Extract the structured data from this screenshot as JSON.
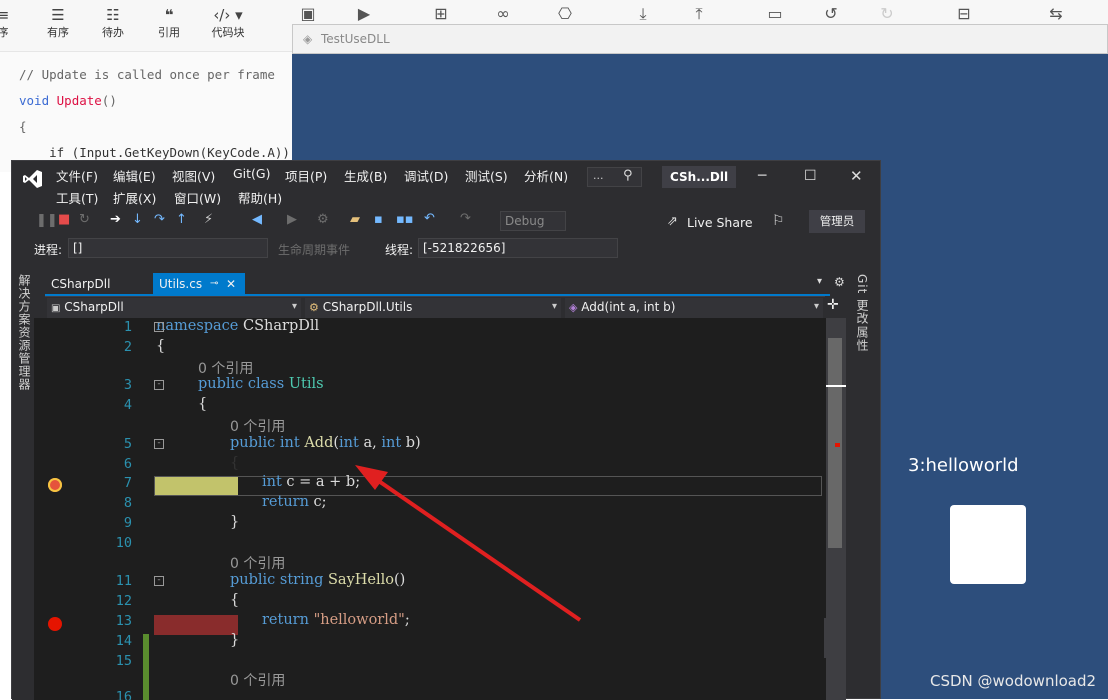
{
  "md_toolbar": {
    "items": [
      {
        "label": "序",
        "icon": "ordered-icon"
      },
      {
        "label": "有序",
        "icon": "ordered-list-icon"
      },
      {
        "label": "待办",
        "icon": "todo-icon"
      },
      {
        "label": "引用",
        "icon": "quote-icon"
      },
      {
        "label": "代码块",
        "icon": "code-block-icon"
      }
    ]
  },
  "md_code": {
    "line1": "// Update is called once per frame",
    "line2_kw": "void",
    "line2_fn": "Update",
    "line2_rest": "()",
    "line3": "{",
    "line4": "    if (Input.GetKeyDown(KeyCode.A))"
  },
  "unity": {
    "title": "TestUseDLL",
    "output_text": "3:helloworld",
    "watermark": "CSDN @wodownload2"
  },
  "vs": {
    "menu_row1": [
      "文件(F)",
      "编辑(E)",
      "视图(V)",
      "Git(G)",
      "项目(P)",
      "生成(B)",
      "调试(D)",
      "测试(S)",
      "分析(N)"
    ],
    "menu_row2": [
      "工具(T)",
      "扩展(X)",
      "窗口(W)",
      "帮助(H)"
    ],
    "search_placeholder": "...",
    "title": "CSh...Dll",
    "config": "Debug",
    "live_share": "Live Share",
    "admin": "管理员",
    "process_label": "进程:",
    "process_value": "[]",
    "lifecycle_label": "生命周期事件",
    "thread_label": "线程:",
    "thread_value": "[-521822656]",
    "tabs": {
      "project": "CSharpDll",
      "file": "Utils.cs"
    },
    "left_side": "解决方案资源管理器",
    "right_side_git": "Git 更改",
    "right_side_props": "属性",
    "nav": {
      "project": "CSharpDll",
      "class": "CSharpDll.Utils",
      "member": "Add(int a, int b)"
    },
    "codelens": "0 个引用",
    "line_numbers": [
      "1",
      "2",
      "3",
      "4",
      "5",
      "6",
      "7",
      "8",
      "9",
      "10",
      "11",
      "12",
      "13",
      "14",
      "15",
      "16"
    ]
  }
}
